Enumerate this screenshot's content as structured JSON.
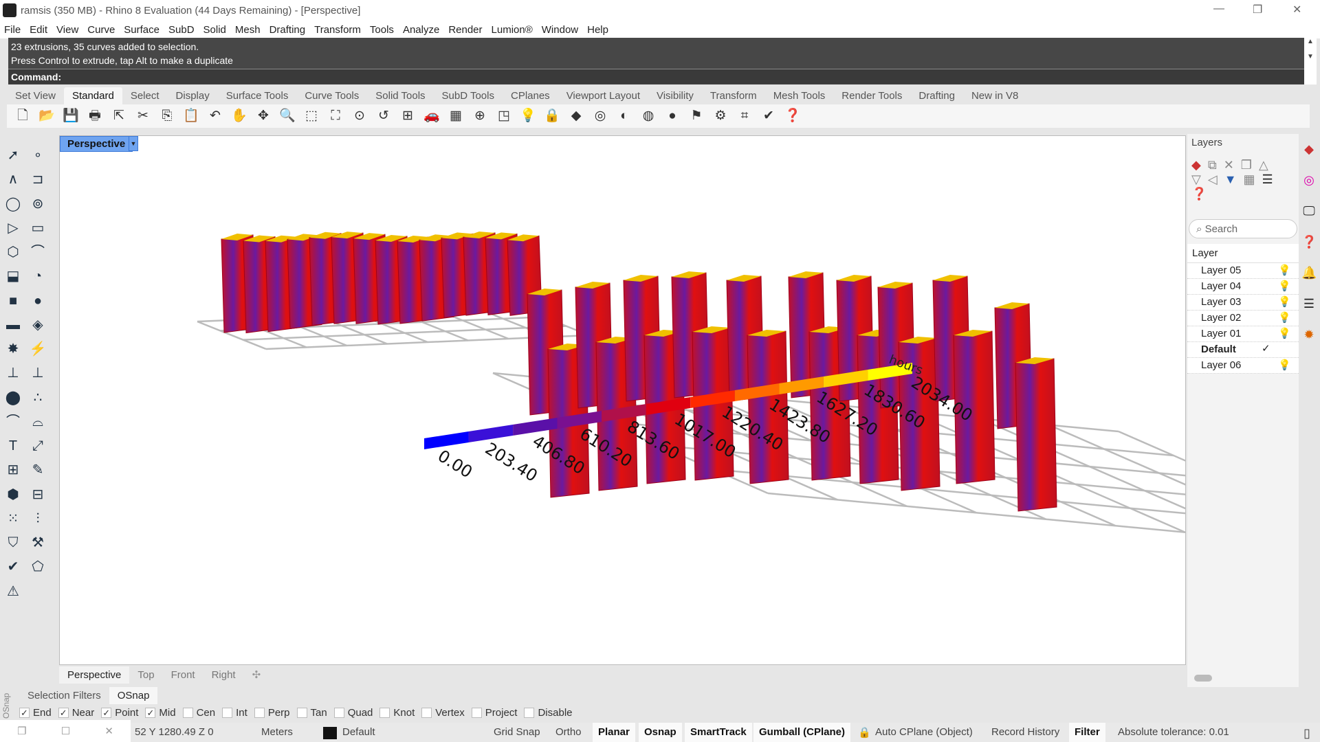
{
  "title": "ramsis (350 MB) - Rhino 8 Evaluation (44 Days Remaining) - [Perspective]",
  "menu": [
    "File",
    "Edit",
    "View",
    "Curve",
    "Surface",
    "SubD",
    "Solid",
    "Mesh",
    "Drafting",
    "Transform",
    "Tools",
    "Analyze",
    "Render",
    "Lumion®",
    "Window",
    "Help"
  ],
  "command": {
    "history": [
      "23 extrusions, 35 curves added to selection.",
      "Press Control to extrude, tap Alt to make a duplicate"
    ],
    "prompt": "Command:"
  },
  "toolbar_tabs": [
    "Set View",
    "Standard",
    "Select",
    "Display",
    "Surface Tools",
    "Curve Tools",
    "Solid Tools",
    "SubD Tools",
    "CPlanes",
    "Viewport Layout",
    "Visibility",
    "Transform",
    "Mesh Tools",
    "Render Tools",
    "Drafting",
    "New in V8"
  ],
  "active_toolbar_tab": "Standard",
  "toolbar_icons": [
    "new-file",
    "open",
    "save",
    "print",
    "export",
    "cut",
    "copy",
    "paste",
    "undo",
    "pan",
    "rotate-view",
    "zoom",
    "zoom-window",
    "zoom-extents",
    "zoom-selected",
    "undo-view",
    "four-viewports",
    "car",
    "grid",
    "gumball",
    "cplane",
    "light",
    "lock",
    "layer",
    "color-wheel",
    "shade",
    "render-preview",
    "render-sphere",
    "select-filter",
    "settings",
    "snap",
    "check",
    "help"
  ],
  "viewport": {
    "label": "Perspective",
    "legend": {
      "unit": "hours",
      "values": [
        "0.00",
        "203.40",
        "406.80",
        "610.20",
        "813.60",
        "1017.00",
        "1220.40",
        "1423.80",
        "1627.20",
        "1830.60",
        "2034.00"
      ],
      "colors": [
        "#0000ff",
        "#3a10d8",
        "#5a10a8",
        "#7a1090",
        "#b0104a",
        "#e00010",
        "#ff2a00",
        "#ff6a00",
        "#ff9a00",
        "#ffd000",
        "#ffff00"
      ]
    }
  },
  "viewport_tabs": [
    "Perspective",
    "Top",
    "Front",
    "Right"
  ],
  "layers": {
    "title": "Layers",
    "search_placeholder": "Search",
    "column": "Layer",
    "rows": [
      {
        "name": "Layer 05",
        "current": false
      },
      {
        "name": "Layer 04",
        "current": false
      },
      {
        "name": "Layer 03",
        "current": false
      },
      {
        "name": "Layer 02",
        "current": false
      },
      {
        "name": "Layer 01",
        "current": false
      },
      {
        "name": "Default",
        "current": true
      },
      {
        "name": "Layer 06",
        "current": false
      }
    ]
  },
  "osnap": {
    "side_label": "OSnap",
    "tabs": [
      "Selection Filters",
      "OSnap"
    ],
    "active_tab": "OSnap",
    "snaps": [
      {
        "label": "End",
        "on": true
      },
      {
        "label": "Near",
        "on": true
      },
      {
        "label": "Point",
        "on": true
      },
      {
        "label": "Mid",
        "on": true
      },
      {
        "label": "Cen",
        "on": false
      },
      {
        "label": "Int",
        "on": false
      },
      {
        "label": "Perp",
        "on": false
      },
      {
        "label": "Tan",
        "on": false
      },
      {
        "label": "Quad",
        "on": false
      },
      {
        "label": "Knot",
        "on": false
      },
      {
        "label": "Vertex",
        "on": false
      },
      {
        "label": "Project",
        "on": false
      },
      {
        "label": "Disable",
        "on": false
      }
    ]
  },
  "status": {
    "coords": "52 Y 1280.49 Z 0",
    "units": "Meters",
    "layer": "Default",
    "grid_snap": "Grid Snap",
    "ortho": "Ortho",
    "planar": "Planar",
    "osnap": "Osnap",
    "smarttrack": "SmartTrack",
    "gumball": "Gumball (CPlane)",
    "auto_cplane": "Auto CPlane (Object)",
    "record_history": "Record History",
    "filter": "Filter",
    "tolerance": "Absolute tolerance: 0.01"
  }
}
